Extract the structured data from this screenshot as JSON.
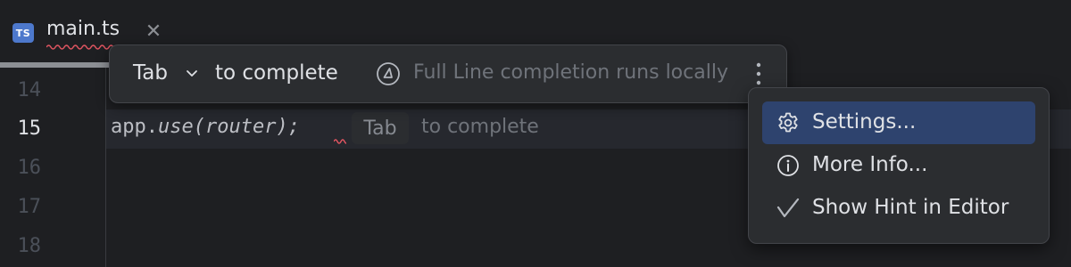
{
  "tab": {
    "icon_text": "TS",
    "filename": "main.ts",
    "close_glyph": "✕"
  },
  "gutter": {
    "lines": [
      "14",
      "15",
      "16",
      "17",
      "18"
    ],
    "current": "15"
  },
  "editor": {
    "code_obj": "app.",
    "code_fn": "use",
    "code_rest": "(router);",
    "inline_tab": "Tab",
    "inline_hint": "to complete"
  },
  "popup": {
    "tab_label": "Tab",
    "complete_label": "to complete",
    "local_text": "Full Line completion runs locally"
  },
  "menu": {
    "items": [
      {
        "label": "Settings...",
        "icon": "gear-icon",
        "selected": true
      },
      {
        "label": "More Info...",
        "icon": "info-icon",
        "selected": false
      },
      {
        "label": "Show Hint in Editor",
        "icon": "checkmark-icon",
        "selected": false
      }
    ]
  },
  "colors": {
    "background": "#1e1f22",
    "popup_bg": "#2b2d30",
    "selection": "#2e436e",
    "ts_badge": "#4d78cc"
  }
}
